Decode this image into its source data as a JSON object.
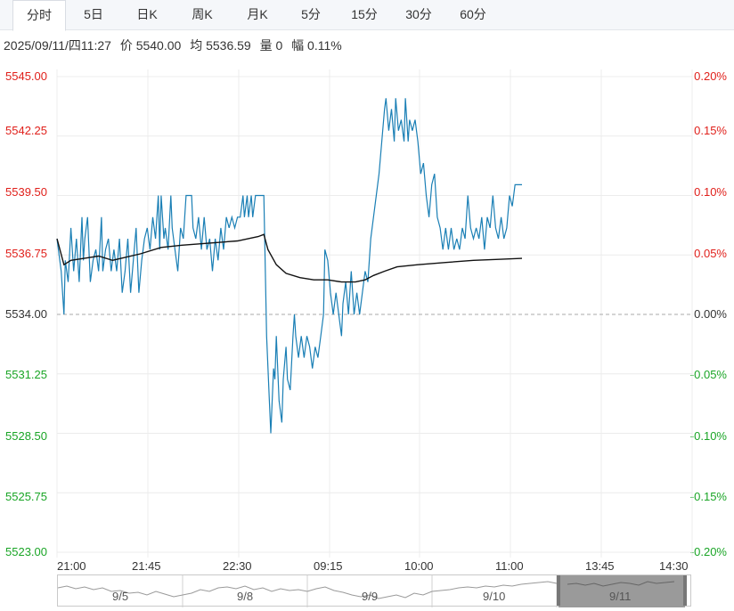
{
  "tabs": [
    {
      "label": "分时",
      "active": true
    },
    {
      "label": "5日",
      "active": false
    },
    {
      "label": "日K",
      "active": false
    },
    {
      "label": "周K",
      "active": false
    },
    {
      "label": "月K",
      "active": false
    },
    {
      "label": "5分",
      "active": false
    },
    {
      "label": "15分",
      "active": false
    },
    {
      "label": "30分",
      "active": false
    },
    {
      "label": "60分",
      "active": false
    }
  ],
  "info": {
    "datetime": "2025/09/11/四11:27",
    "price": "价 5540.00",
    "avg": "均 5536.59",
    "volume": "量 0",
    "change": "幅 0.11%"
  },
  "colors": {
    "up": "#e0201b",
    "down": "#1aa526",
    "price_line": "#1a7fb5",
    "avg_line": "#111111",
    "grid": "#ececec",
    "baseline": "#aaaaaa"
  },
  "chart_data": {
    "type": "line",
    "title": "",
    "xlabel": "",
    "ylabel": "",
    "ylim": [
      5523.0,
      5545.0
    ],
    "y2lim": [
      -0.2,
      0.2
    ],
    "reference_price": 5534.0,
    "y_ticks": [
      "5545.00",
      "5542.25",
      "5539.50",
      "5536.75",
      "5534.00",
      "5531.25",
      "5528.50",
      "5525.75",
      "5523.00"
    ],
    "y2_ticks": [
      "0.20%",
      "0.15%",
      "0.10%",
      "0.05%",
      "0.00%",
      "-0.05%",
      "-0.10%",
      "-0.15%",
      "-0.20%"
    ],
    "x_ticks": [
      "21:00",
      "21:45",
      "22:30",
      "09:15",
      "10:00",
      "11:00",
      "13:45",
      "14:30"
    ],
    "grid": true,
    "series": [
      {
        "type": "price",
        "points": [
          [
            0,
            5537.5
          ],
          [
            3,
            5536.0
          ],
          [
            5,
            5534.0
          ],
          [
            6,
            5536.5
          ],
          [
            8,
            5535.5
          ],
          [
            10,
            5538.0
          ],
          [
            12,
            5536.0
          ],
          [
            14,
            5537.5
          ],
          [
            16,
            5535.5
          ],
          [
            18,
            5538.5
          ],
          [
            19,
            5536.5
          ],
          [
            20,
            5537.5
          ],
          [
            22,
            5538.5
          ],
          [
            24,
            5535.5
          ],
          [
            26,
            5536.5
          ],
          [
            28,
            5537.0
          ],
          [
            30,
            5536.0
          ],
          [
            32,
            5538.5
          ],
          [
            33,
            5536.0
          ],
          [
            35,
            5537.0
          ],
          [
            37,
            5537.5
          ],
          [
            39,
            5536.0
          ],
          [
            41,
            5537.0
          ],
          [
            43,
            5536.0
          ],
          [
            45,
            5537.5
          ],
          [
            47,
            5535.0
          ],
          [
            49,
            5536.0
          ],
          [
            51,
            5537.5
          ],
          [
            53,
            5535.0
          ],
          [
            55,
            5536.5
          ],
          [
            57,
            5538.0
          ],
          [
            59,
            5535.0
          ],
          [
            61,
            5536.5
          ],
          [
            63,
            5537.5
          ],
          [
            65,
            5538.0
          ],
          [
            67,
            5537.0
          ],
          [
            69,
            5538.5
          ],
          [
            71,
            5537.5
          ],
          [
            73,
            5539.5
          ],
          [
            74,
            5537.0
          ],
          [
            75,
            5539.5
          ],
          [
            77,
            5537.5
          ],
          [
            78,
            5538.0
          ],
          [
            80,
            5537.0
          ],
          [
            82,
            5539.5
          ],
          [
            83,
            5538.0
          ],
          [
            85,
            5537.0
          ],
          [
            87,
            5536.0
          ],
          [
            89,
            5538.0
          ],
          [
            91,
            5537.5
          ],
          [
            93,
            5539.5
          ],
          [
            97,
            5539.5
          ],
          [
            98,
            5538.0
          ],
          [
            100,
            5537.5
          ],
          [
            102,
            5538.5
          ],
          [
            104,
            5537.0
          ],
          [
            106,
            5538.5
          ],
          [
            108,
            5537.0
          ],
          [
            110,
            5537.5
          ],
          [
            112,
            5536.0
          ],
          [
            114,
            5537.5
          ],
          [
            116,
            5536.5
          ],
          [
            118,
            5538.0
          ],
          [
            120,
            5537.0
          ],
          [
            122,
            5538.5
          ],
          [
            124,
            5538.0
          ],
          [
            126,
            5538.5
          ],
          [
            128,
            5538.0
          ],
          [
            130,
            5538.5
          ],
          [
            132,
            5538.5
          ],
          [
            134,
            5539.5
          ],
          [
            135,
            5538.5
          ],
          [
            137,
            5539.5
          ],
          [
            138,
            5538.5
          ],
          [
            140,
            5539.5
          ],
          [
            141,
            5538.5
          ],
          [
            143,
            5539.5
          ],
          [
            149,
            5539.5
          ],
          [
            151,
            5533.0
          ],
          [
            153,
            5530.0
          ],
          [
            154,
            5528.5
          ],
          [
            156,
            5531.5
          ],
          [
            157,
            5531.0
          ],
          [
            158,
            5533.0
          ],
          [
            160,
            5530.0
          ],
          [
            162,
            5529.0
          ],
          [
            163,
            5531.0
          ],
          [
            165,
            5532.5
          ],
          [
            166,
            5531.0
          ],
          [
            168,
            5530.5
          ],
          [
            170,
            5533.0
          ],
          [
            171,
            5534.0
          ],
          [
            172,
            5533.0
          ],
          [
            174,
            5532.0
          ],
          [
            176,
            5533.0
          ],
          [
            178,
            5532.0
          ],
          [
            180,
            5533.0
          ],
          [
            182,
            5532.5
          ],
          [
            184,
            5531.5
          ],
          [
            186,
            5532.5
          ],
          [
            188,
            5532.0
          ],
          [
            190,
            5533.0
          ],
          [
            192,
            5534.0
          ],
          [
            193,
            5537.0
          ],
          [
            195,
            5536.5
          ],
          [
            197,
            5535.0
          ],
          [
            199,
            5534.0
          ],
          [
            201,
            5535.0
          ],
          [
            203,
            5534.0
          ],
          [
            205,
            5533.0
          ],
          [
            206,
            5534.5
          ],
          [
            208,
            5535.5
          ],
          [
            210,
            5534.0
          ],
          [
            212,
            5536.0
          ],
          [
            214,
            5534.0
          ],
          [
            216,
            5535.0
          ],
          [
            218,
            5534.0
          ],
          [
            220,
            5535.0
          ],
          [
            222,
            5536.0
          ],
          [
            224,
            5535.5
          ],
          [
            226,
            5537.5
          ],
          [
            228,
            5538.5
          ],
          [
            230,
            5539.5
          ],
          [
            232,
            5540.5
          ],
          [
            234,
            5542.0
          ],
          [
            236,
            5543.5
          ],
          [
            237,
            5544.0
          ],
          [
            239,
            5542.5
          ],
          [
            241,
            5543.5
          ],
          [
            243,
            5542.0
          ],
          [
            244,
            5544.0
          ],
          [
            246,
            5542.5
          ],
          [
            248,
            5543.0
          ],
          [
            250,
            5542.0
          ],
          [
            251,
            5544.0
          ],
          [
            253,
            5542.0
          ],
          [
            254,
            5543.0
          ],
          [
            256,
            5542.5
          ],
          [
            258,
            5543.0
          ],
          [
            260,
            5542.0
          ],
          [
            262,
            5540.5
          ],
          [
            264,
            5541.0
          ],
          [
            266,
            5539.5
          ],
          [
            268,
            5538.5
          ],
          [
            270,
            5540.0
          ],
          [
            272,
            5540.5
          ],
          [
            274,
            5538.5
          ],
          [
            276,
            5538.0
          ],
          [
            278,
            5537.0
          ],
          [
            280,
            5538.0
          ],
          [
            282,
            5537.0
          ],
          [
            284,
            5538.0
          ],
          [
            286,
            5537.0
          ],
          [
            288,
            5537.5
          ],
          [
            290,
            5537.0
          ],
          [
            292,
            5538.0
          ],
          [
            294,
            5537.5
          ],
          [
            296,
            5539.5
          ],
          [
            298,
            5538.0
          ],
          [
            300,
            5537.5
          ],
          [
            302,
            5538.0
          ],
          [
            304,
            5537.5
          ],
          [
            306,
            5538.5
          ],
          [
            308,
            5537.0
          ],
          [
            310,
            5538.5
          ],
          [
            312,
            5538.0
          ],
          [
            314,
            5539.5
          ],
          [
            316,
            5538.0
          ],
          [
            318,
            5537.5
          ],
          [
            320,
            5538.5
          ],
          [
            322,
            5537.5
          ],
          [
            324,
            5538.0
          ],
          [
            326,
            5539.5
          ],
          [
            328,
            5539.0
          ],
          [
            330,
            5540.0
          ],
          [
            335,
            5540.0
          ]
        ]
      },
      {
        "type": "average",
        "points": [
          [
            0,
            5537.5
          ],
          [
            5,
            5536.3
          ],
          [
            10,
            5536.5
          ],
          [
            20,
            5536.6
          ],
          [
            30,
            5536.7
          ],
          [
            40,
            5536.5
          ],
          [
            60,
            5536.8
          ],
          [
            75,
            5537.1
          ],
          [
            90,
            5537.2
          ],
          [
            110,
            5537.3
          ],
          [
            130,
            5537.4
          ],
          [
            145,
            5537.6
          ],
          [
            149,
            5537.7
          ],
          [
            152,
            5537.0
          ],
          [
            158,
            5536.3
          ],
          [
            165,
            5535.9
          ],
          [
            175,
            5535.7
          ],
          [
            185,
            5535.6
          ],
          [
            195,
            5535.6
          ],
          [
            205,
            5535.5
          ],
          [
            215,
            5535.5
          ],
          [
            222,
            5535.6
          ],
          [
            228,
            5535.8
          ],
          [
            236,
            5536.0
          ],
          [
            245,
            5536.2
          ],
          [
            260,
            5536.3
          ],
          [
            280,
            5536.4
          ],
          [
            300,
            5536.5
          ],
          [
            320,
            5536.55
          ],
          [
            335,
            5536.59
          ]
        ]
      }
    ]
  },
  "navigator": {
    "dates": [
      "9/5",
      "9/8",
      "9/9",
      "9/10",
      "9/11"
    ]
  }
}
